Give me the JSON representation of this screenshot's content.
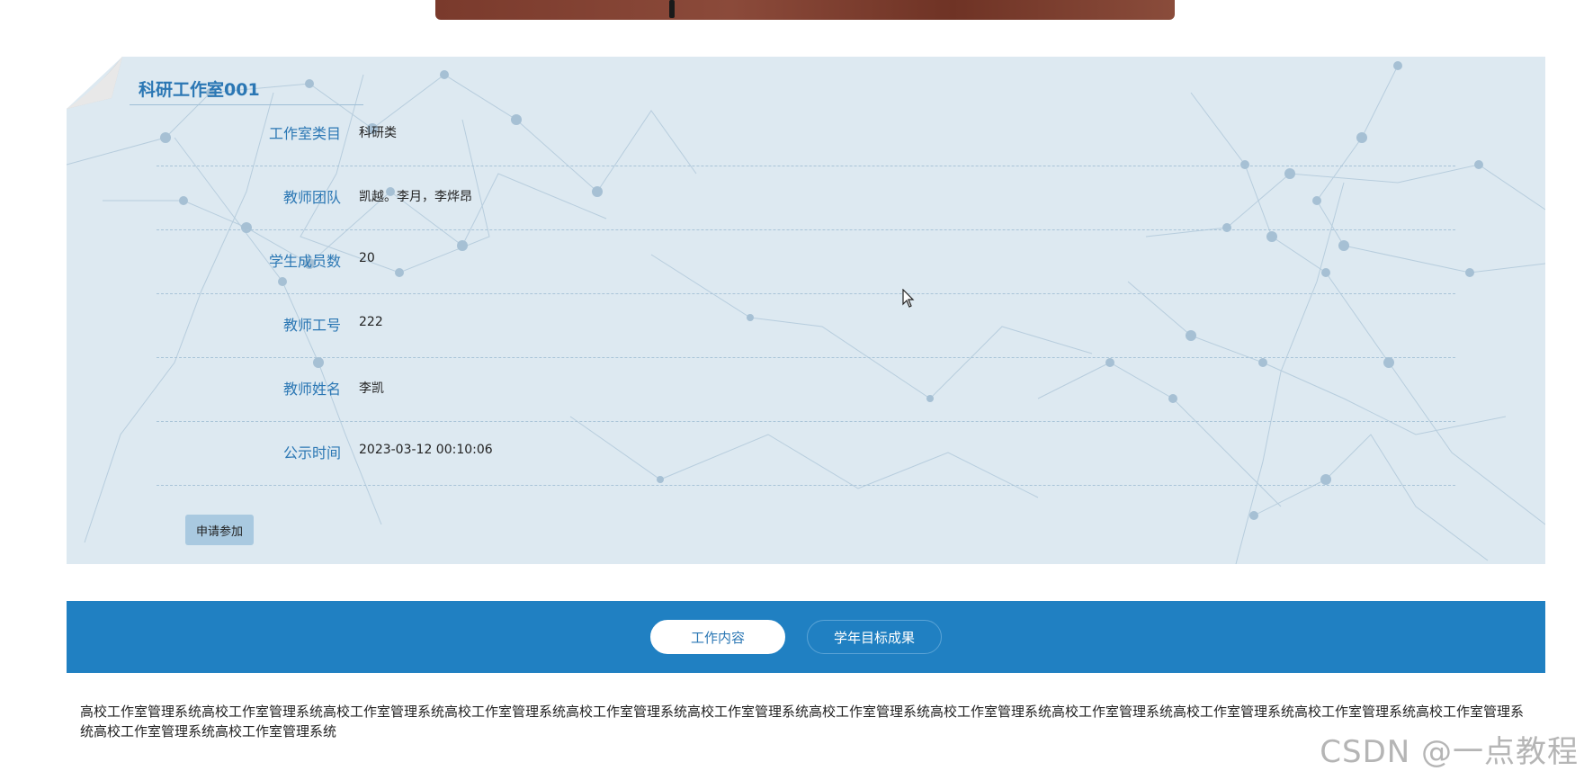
{
  "panel": {
    "title": "科研工作室001",
    "fields": [
      {
        "label": "工作室类目",
        "value": "科研类"
      },
      {
        "label": "教师团队",
        "value": "凯越。李月，李烨昂"
      },
      {
        "label": "学生成员数",
        "value": "20"
      },
      {
        "label": "教师工号",
        "value": "222"
      },
      {
        "label": "教师姓名",
        "value": "李凯"
      },
      {
        "label": "公示时间",
        "value": "2023-03-12 00:10:06"
      }
    ],
    "apply_label": "申请参加"
  },
  "tabs": [
    {
      "label": "工作内容",
      "active": true
    },
    {
      "label": "学年目标成果",
      "active": false
    }
  ],
  "content": {
    "text": "高校工作室管理系统高校工作室管理系统高校工作室管理系统高校工作室管理系统高校工作室管理系统高校工作室管理系统高校工作室管理系统高校工作室管理系统高校工作室管理系统高校工作室管理系统高校工作室管理系统高校工作室管理系统高校工作室管理系统高校工作室管理系统"
  },
  "watermark": "CSDN @一点教程",
  "colors": {
    "accent": "#2080c2",
    "label_blue": "#2b77b4",
    "panel_bg": "#dde9f1",
    "button_bg": "#a9c9e0"
  },
  "icons": {
    "corner": "page-curl-icon",
    "cursor": "mouse-cursor-icon"
  }
}
